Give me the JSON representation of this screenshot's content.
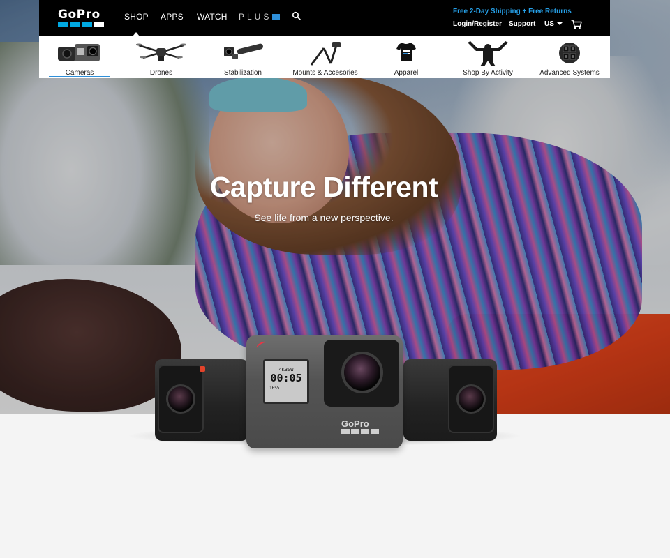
{
  "header": {
    "logo_text": "GoPro",
    "nav_links": [
      {
        "label": "SHOP",
        "active": true
      },
      {
        "label": "APPS",
        "active": false
      },
      {
        "label": "WATCH",
        "active": false
      }
    ],
    "plus_label": "PLUS",
    "shipping_promo": "Free 2-Day Shipping + Free Returns",
    "login_label": "Login/Register",
    "support_label": "Support",
    "region_label": "US",
    "icons": {
      "search": "search-icon",
      "cart": "cart-icon",
      "region": "chevron-down-icon"
    },
    "colors": {
      "accent": "#26a0e8",
      "bar": "#000000"
    }
  },
  "categories": [
    {
      "label": "Cameras",
      "icon": "camera-icon",
      "active": true
    },
    {
      "label": "Drones",
      "icon": "drone-icon",
      "active": false
    },
    {
      "label": "Stabilization",
      "icon": "gimbal-icon",
      "active": false
    },
    {
      "label": "Mounts & Accesories",
      "icon": "mount-icon",
      "active": false
    },
    {
      "label": "Apparel",
      "icon": "tshirt-icon",
      "active": false
    },
    {
      "label": "Shop By Activity",
      "icon": "activity-icon",
      "active": false
    },
    {
      "label": "Advanced Systems",
      "icon": "spherical-rig-icon",
      "active": false
    }
  ],
  "hero": {
    "title": "Capture Different",
    "subtitle": "See life from a new perspective."
  },
  "products": {
    "hero5_screen_mode": "4K30W",
    "hero5_screen_time": "00:05",
    "hero5_screen_battery": "1H55",
    "hero5_brand": "GoPro"
  }
}
